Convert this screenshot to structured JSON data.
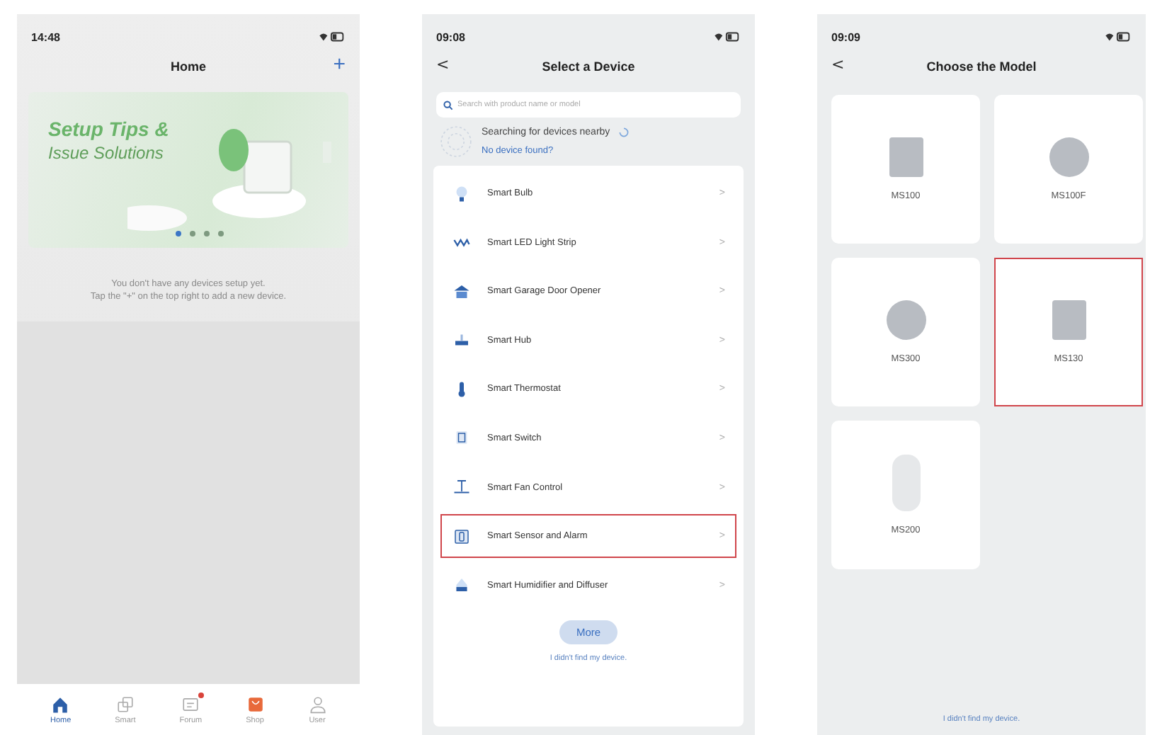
{
  "screens": [
    {
      "kind": "home",
      "status_time": "14:48",
      "title": "Home",
      "add_button": "+",
      "banner": {
        "title": "Setup Tips &",
        "subtitle": "Issue Solutions",
        "dots": [
          {
            "selected": true
          },
          {
            "selected": false
          },
          {
            "selected": false
          },
          {
            "selected": false
          }
        ]
      },
      "empty_message": [
        "You don't have any devices setup yet.",
        "Tap the \"+\" on the top right to add a new device."
      ],
      "tabs": [
        {
          "label": "Home",
          "selected": true,
          "badge": false
        },
        {
          "label": "Smart",
          "selected": false,
          "badge": false
        },
        {
          "label": "Forum",
          "selected": false,
          "badge": true
        },
        {
          "label": "Shop",
          "selected": false,
          "badge": false
        },
        {
          "label": "User",
          "selected": false,
          "badge": false
        }
      ]
    },
    {
      "kind": "device_list",
      "status_time": "09:08",
      "back": "<",
      "title": "Select a Device",
      "search": {
        "placeholder": "Search with product name or model"
      },
      "scan_status": "Searching for devices nearby",
      "scan_link": "No device found?",
      "items": [
        {
          "label": "Smart Bulb",
          "highlighted": false
        },
        {
          "label": "Smart LED Light Strip",
          "highlighted": false
        },
        {
          "label": "Smart Garage Door Opener",
          "highlighted": false
        },
        {
          "label": "Smart Hub",
          "highlighted": false
        },
        {
          "label": "Smart Thermostat",
          "highlighted": false
        },
        {
          "label": "Smart Switch",
          "highlighted": false
        },
        {
          "label": "Smart Fan Control",
          "highlighted": false
        },
        {
          "label": "Smart Sensor and Alarm",
          "highlighted": true
        },
        {
          "label": "Smart Humidifier and Diffuser",
          "highlighted": false
        }
      ],
      "chevron": ">",
      "more_button": "More",
      "footer_link": "I didn't find my device."
    },
    {
      "kind": "model_grid",
      "status_time": "09:09",
      "back": "<",
      "title": "Choose the Model",
      "models": [
        {
          "label": "MS100",
          "highlighted": false
        },
        {
          "label": "MS100F",
          "highlighted": false
        },
        {
          "label": "MS300",
          "highlighted": false
        },
        {
          "label": "MS130",
          "highlighted": true
        },
        {
          "label": "MS200",
          "highlighted": false
        }
      ],
      "footer_link": "I didn't find my device."
    }
  ]
}
